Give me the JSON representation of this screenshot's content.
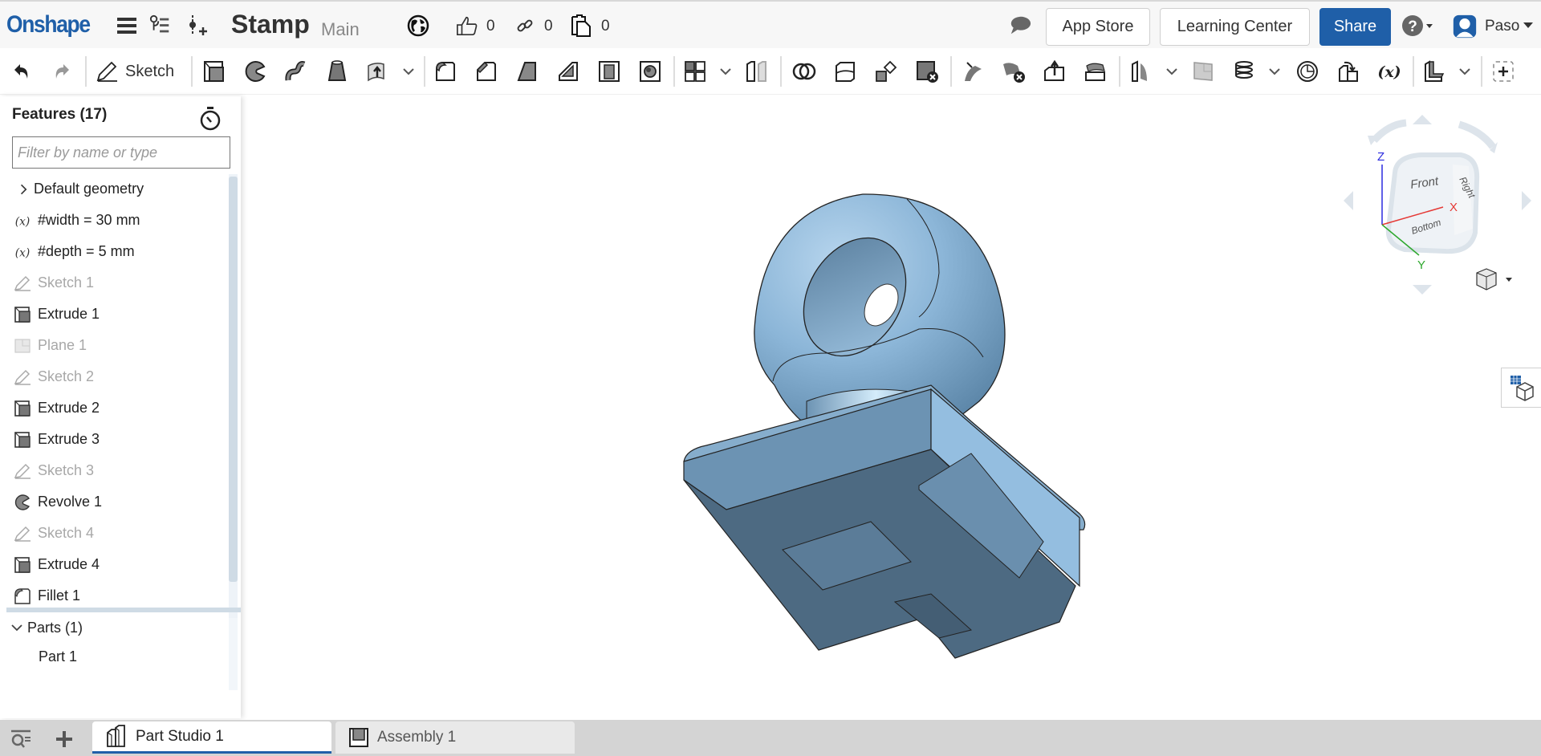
{
  "header": {
    "logo": "Onshape",
    "document_title": "Stamp",
    "branch": "Main",
    "likes_count": "0",
    "links_count": "0",
    "copies_count": "0",
    "app_store_label": "App Store",
    "learning_center_label": "Learning Center",
    "share_label": "Share",
    "user_name": "Paso",
    "icons": [
      "hamburger-menu-icon",
      "versions-graph-icon",
      "insert-version-icon",
      "globe-public-icon",
      "thumbs-up-icon",
      "link-icon",
      "copy-document-icon",
      "comment-icon",
      "help-icon",
      "user-avatar-icon"
    ]
  },
  "toolbar": {
    "sketch_label": "Sketch",
    "tools": [
      "undo",
      "redo",
      "sketch",
      "extrude",
      "revolve",
      "sweep",
      "loft",
      "thicken",
      "fillet",
      "chamfer",
      "draft",
      "rib",
      "shell",
      "hole",
      "linear-pattern",
      "mirror",
      "boolean",
      "split",
      "transform",
      "delete-part",
      "modify-fillet",
      "delete-face",
      "move-face",
      "replace-face",
      "plane",
      "plane-point",
      "helix",
      "mate-connector",
      "derived",
      "variable",
      "sheet-metal",
      "add-custom-feature"
    ]
  },
  "features": {
    "title": "Features (17)",
    "filter_placeholder": "Filter by name or type",
    "items": [
      {
        "label": "Default geometry",
        "icon": "chevron-right",
        "dim": false
      },
      {
        "label": "#width = 30 mm",
        "icon": "variable",
        "dim": false
      },
      {
        "label": "#depth = 5 mm",
        "icon": "variable",
        "dim": false
      },
      {
        "label": "Sketch 1",
        "icon": "sketch",
        "dim": true
      },
      {
        "label": "Extrude 1",
        "icon": "extrude",
        "dim": false
      },
      {
        "label": "Plane 1",
        "icon": "plane",
        "dim": true
      },
      {
        "label": "Sketch 2",
        "icon": "sketch",
        "dim": true
      },
      {
        "label": "Extrude 2",
        "icon": "extrude",
        "dim": false
      },
      {
        "label": "Extrude 3",
        "icon": "extrude",
        "dim": false
      },
      {
        "label": "Sketch 3",
        "icon": "sketch",
        "dim": true
      },
      {
        "label": "Revolve 1",
        "icon": "revolve",
        "dim": false
      },
      {
        "label": "Sketch 4",
        "icon": "sketch",
        "dim": true
      },
      {
        "label": "Extrude 4",
        "icon": "extrude",
        "dim": false
      },
      {
        "label": "Fillet 1",
        "icon": "fillet",
        "dim": false
      }
    ],
    "parts_label": "Parts (1)",
    "parts": [
      "Part 1"
    ]
  },
  "viewcube": {
    "faces": {
      "front": "Front",
      "right": "Right",
      "bottom": "Bottom"
    },
    "axes": {
      "x": "X",
      "y": "Y",
      "z": "Z"
    },
    "colors": {
      "x": "#e53935",
      "y": "#2ea82e",
      "z": "#2b2bdf"
    }
  },
  "tabs": [
    {
      "label": "Part Studio 1",
      "active": true
    },
    {
      "label": "Assembly 1",
      "active": false
    }
  ],
  "colors": {
    "brand": "#1f5fa8",
    "model_fill": "#8ab4d4"
  }
}
